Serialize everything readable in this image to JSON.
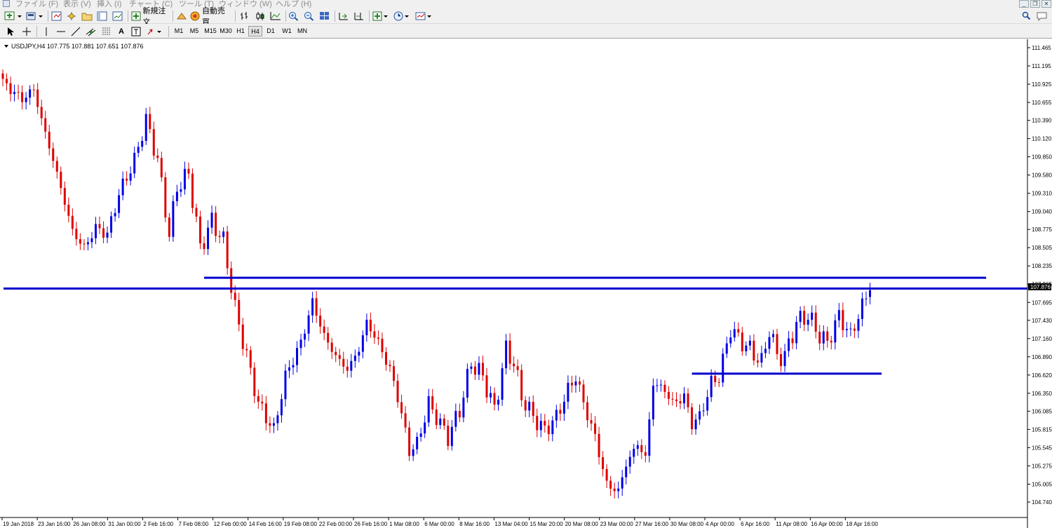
{
  "menubar": {
    "items": [
      {
        "label": "ファイル (F)"
      },
      {
        "label": "表示 (V)"
      },
      {
        "label": "挿入 (I)"
      },
      {
        "label": "チャート (C)"
      },
      {
        "label": "ツール (T)"
      },
      {
        "label": "ウィンドウ (W)"
      },
      {
        "label": "ヘルプ (H)"
      }
    ]
  },
  "toolbar": {
    "new_order_label": "新規注文",
    "auto_trade_label": "自動売買",
    "timeframes": [
      "M1",
      "M5",
      "M15",
      "M30",
      "H1",
      "H4",
      "D1",
      "W1",
      "MN"
    ],
    "active_timeframe": "H4"
  },
  "chart": {
    "header": "USDJPY,H4  107.775 107.881 107.651 107.876",
    "current_price_label": "107.876",
    "colors": {
      "bull": "#0000e6",
      "bear": "#dd0000",
      "line": "#0000cc",
      "price_tag": "#000000"
    }
  },
  "chart_data": {
    "type": "candlestick",
    "symbol": "USDJPY",
    "timeframe": "H4",
    "ohlc_last": {
      "open": 107.775,
      "high": 107.881,
      "low": 107.651,
      "close": 107.876
    },
    "y_ticks": [
      111.465,
      111.195,
      110.925,
      110.655,
      110.39,
      110.12,
      109.85,
      109.58,
      109.31,
      109.04,
      108.775,
      108.505,
      108.235,
      107.965,
      107.695,
      107.43,
      107.16,
      106.89,
      106.62,
      106.35,
      106.085,
      105.815,
      105.545,
      105.275,
      105.005,
      104.74
    ],
    "y_tick_labels": [
      "111.465",
      "111.195",
      "110.925",
      "110.655",
      "110.390",
      "110.120",
      "109.850",
      "109.580",
      "109.310",
      "109.040",
      "108.775",
      "108.505",
      "108.235",
      "107.965",
      "107.695",
      "107.430",
      "107.160",
      "106.890",
      "106.620",
      "106.350",
      "106.085",
      "105.815",
      "105.545",
      "105.275",
      "105.005",
      "104.740"
    ],
    "x_ticks": [
      "19 Jan 2018",
      "23 Jan 16:00",
      "26 Jan 08:00",
      "31 Jan 00:00",
      "2 Feb 16:00",
      "7 Feb 08:00",
      "12 Feb 00:00",
      "14 Feb 16:00",
      "19 Feb 08:00",
      "22 Feb 00:00",
      "26 Feb 16:00",
      "1 Mar 08:00",
      "6 Mar 00:00",
      "8 Mar 16:00",
      "13 Mar 04:00",
      "15 Mar 20:00",
      "20 Mar 08:00",
      "23 Mar 00:00",
      "27 Mar 16:00",
      "30 Mar 08:00",
      "4 Apr 00:00",
      "6 Apr 16:00",
      "11 Apr 08:00",
      "16 Apr 00:00",
      "18 Apr 16:00"
    ],
    "horizontal_lines": [
      {
        "price": 108.06,
        "from_index": 52,
        "to_index": 254
      },
      {
        "price": 107.9,
        "from_index": 0,
        "to_index": 270
      },
      {
        "price": 106.64,
        "from_index": 178,
        "to_index": 227
      }
    ],
    "anchors": [
      [
        0,
        110.95
      ],
      [
        5,
        110.7
      ],
      [
        8,
        110.85
      ],
      [
        10,
        110.4
      ],
      [
        14,
        109.6
      ],
      [
        18,
        108.75
      ],
      [
        21,
        108.5
      ],
      [
        24,
        108.8
      ],
      [
        27,
        108.7
      ],
      [
        30,
        109.3
      ],
      [
        34,
        109.8
      ],
      [
        37,
        110.4
      ],
      [
        40,
        109.8
      ],
      [
        43,
        108.7
      ],
      [
        45,
        109.4
      ],
      [
        48,
        109.6
      ],
      [
        51,
        108.5
      ],
      [
        54,
        108.9
      ],
      [
        57,
        108.6
      ],
      [
        60,
        107.6
      ],
      [
        63,
        106.9
      ],
      [
        66,
        106.2
      ],
      [
        70,
        105.8
      ],
      [
        73,
        106.6
      ],
      [
        77,
        107.1
      ],
      [
        80,
        107.7
      ],
      [
        83,
        107.2
      ],
      [
        86,
        106.9
      ],
      [
        89,
        106.7
      ],
      [
        92,
        107.0
      ],
      [
        94,
        107.4
      ],
      [
        97,
        107.1
      ],
      [
        100,
        106.7
      ],
      [
        102,
        106.3
      ],
      [
        105,
        105.5
      ],
      [
        107,
        105.6
      ],
      [
        110,
        106.2
      ],
      [
        112,
        106.0
      ],
      [
        115,
        105.7
      ],
      [
        118,
        106.1
      ],
      [
        121,
        106.8
      ],
      [
        124,
        106.6
      ],
      [
        127,
        106.1
      ],
      [
        130,
        107.0
      ],
      [
        132,
        106.8
      ],
      [
        134,
        106.3
      ],
      [
        137,
        106.0
      ],
      [
        140,
        105.8
      ],
      [
        143,
        106.0
      ],
      [
        146,
        106.4
      ],
      [
        148,
        106.6
      ],
      [
        150,
        106.2
      ],
      [
        153,
        105.7
      ],
      [
        156,
        105.0
      ],
      [
        159,
        104.9
      ],
      [
        161,
        105.3
      ],
      [
        164,
        105.6
      ],
      [
        166,
        105.4
      ],
      [
        168,
        106.5
      ],
      [
        171,
        106.4
      ],
      [
        173,
        106.2
      ],
      [
        176,
        106.3
      ],
      [
        178,
        105.9
      ],
      [
        180,
        106.0
      ],
      [
        183,
        106.5
      ],
      [
        185,
        106.6
      ],
      [
        188,
        107.3
      ],
      [
        191,
        107.1
      ],
      [
        193,
        107.0
      ],
      [
        196,
        106.8
      ],
      [
        198,
        107.3
      ],
      [
        200,
        106.9
      ],
      [
        202,
        106.9
      ],
      [
        205,
        107.4
      ],
      [
        208,
        107.5
      ],
      [
        211,
        107.2
      ],
      [
        213,
        107.1
      ],
      [
        216,
        107.5
      ],
      [
        219,
        107.2
      ],
      [
        222,
        107.65
      ],
      [
        224,
        107.9
      ]
    ]
  }
}
